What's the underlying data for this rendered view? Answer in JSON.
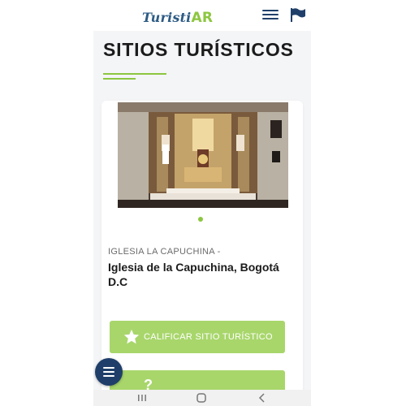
{
  "app": {
    "logo_part1": "Turisti",
    "logo_part2": "AR"
  },
  "page": {
    "heading": "SITIOS TURÍSTICOS"
  },
  "site": {
    "subtitle": "IGLESIA LA CAPUCHINA -",
    "title": "Iglesia de la Capuchina, Bogotá D.C"
  },
  "actions": {
    "rate_label": "CALIFICAR SITIO TURÍSTICO"
  },
  "colors": {
    "accent_green": "#8cc63f",
    "button_green": "#a8d66b",
    "brand_blue": "#1f3f6a"
  },
  "icons": {
    "menu": "hamburger-menu-icon",
    "flag": "flag-icon",
    "star": "star-icon",
    "fab": "hamburger-menu-icon",
    "recents": "recents-icon",
    "home": "home-icon",
    "back": "back-icon"
  }
}
